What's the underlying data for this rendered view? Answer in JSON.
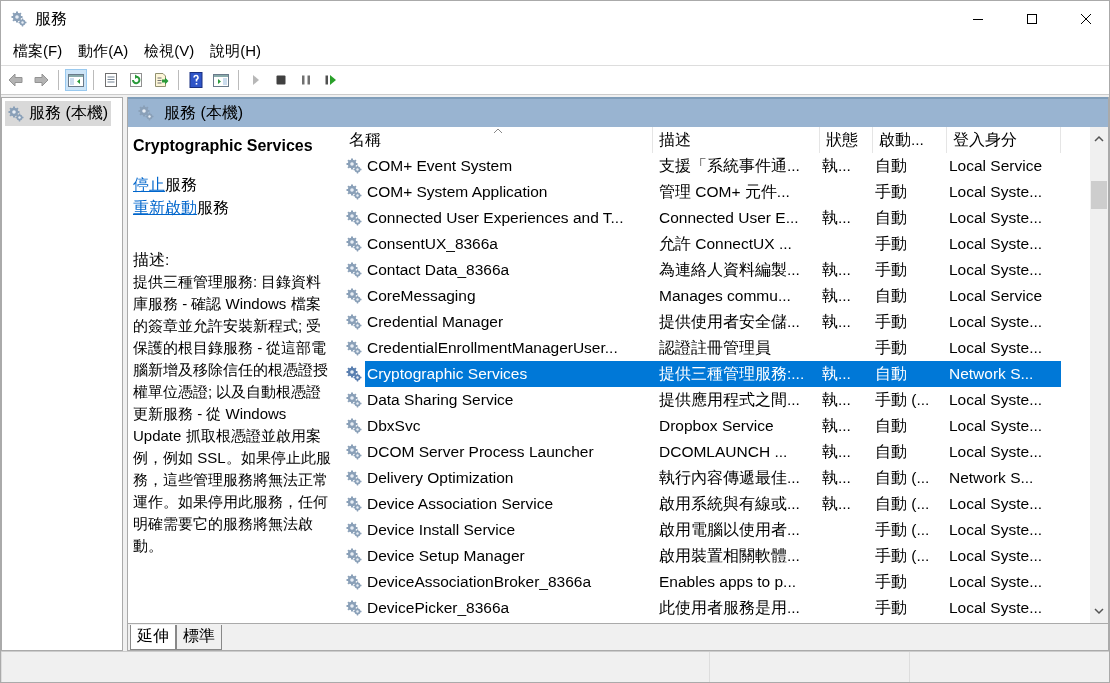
{
  "window": {
    "title": "服務"
  },
  "menu": [
    "檔案(F)",
    "動作(A)",
    "檢視(V)",
    "說明(H)"
  ],
  "toolbar": [
    {
      "kind": "back",
      "disabled": true,
      "selected": false
    },
    {
      "kind": "forward",
      "disabled": true,
      "selected": false
    },
    {
      "kind": "separator"
    },
    {
      "kind": "tree-toggle",
      "disabled": false,
      "selected": true
    },
    {
      "kind": "separator"
    },
    {
      "kind": "properties",
      "disabled": false,
      "selected": false
    },
    {
      "kind": "refresh",
      "disabled": false,
      "selected": false
    },
    {
      "kind": "export",
      "disabled": false,
      "selected": false
    },
    {
      "kind": "separator"
    },
    {
      "kind": "help",
      "disabled": false,
      "selected": false
    },
    {
      "kind": "action-pane",
      "disabled": false,
      "selected": false
    },
    {
      "kind": "separator"
    },
    {
      "kind": "play",
      "disabled": true,
      "selected": false
    },
    {
      "kind": "stop",
      "disabled": false,
      "selected": false
    },
    {
      "kind": "pause",
      "disabled": false,
      "selected": false
    },
    {
      "kind": "resume",
      "disabled": false,
      "selected": false
    }
  ],
  "tree": {
    "items": [
      {
        "label": "服務 (本機)",
        "selected": true
      }
    ]
  },
  "panel": {
    "title": "服務 (本機)"
  },
  "details": {
    "name": "Cryptographic Services",
    "actions": [
      {
        "link": "停止",
        "text": "服務"
      },
      {
        "link": "重新啟動",
        "text": "服務"
      }
    ],
    "description_label": "描述:",
    "description": "提供三種管理服務: 目錄資料庫服務 - 確認 Windows 檔案的簽章並允許安裝新程式; 受保護的根目錄服務 - 從這部電腦新增及移除信任的根憑證授權單位憑證; 以及自動根憑證更新服務 - 從 Windows Update 抓取根憑證並啟用案例，例如 SSL。如果停止此服務，這些管理服務將無法正常運作。如果停用此服務，任何明確需要它的服務將無法啟動。"
  },
  "table": {
    "columns": [
      {
        "label": "名稱",
        "sorted": true
      },
      {
        "label": "描述"
      },
      {
        "label": "狀態"
      },
      {
        "label": "啟動..."
      },
      {
        "label": "登入身分"
      }
    ],
    "rows": [
      {
        "name": "COM+ Event System",
        "description": "支援「系統事件通...",
        "status": "執...",
        "startup": "自動",
        "logon": "Local Service",
        "selected": false
      },
      {
        "name": "COM+ System Application",
        "description": "管理 COM+ 元件...",
        "status": "",
        "startup": "手動",
        "logon": "Local Syste...",
        "selected": false
      },
      {
        "name": "Connected User Experiences and T...",
        "description": "Connected User E...",
        "status": "執...",
        "startup": "自動",
        "logon": "Local Syste...",
        "selected": false
      },
      {
        "name": "ConsentUX_8366a",
        "description": "允許 ConnectUX ...",
        "status": "",
        "startup": "手動",
        "logon": "Local Syste...",
        "selected": false
      },
      {
        "name": "Contact Data_8366a",
        "description": "為連絡人資料編製...",
        "status": "執...",
        "startup": "手動",
        "logon": "Local Syste...",
        "selected": false
      },
      {
        "name": "CoreMessaging",
        "description": "Manages commu...",
        "status": "執...",
        "startup": "自動",
        "logon": "Local Service",
        "selected": false
      },
      {
        "name": "Credential Manager",
        "description": "提供使用者安全儲...",
        "status": "執...",
        "startup": "手動",
        "logon": "Local Syste...",
        "selected": false
      },
      {
        "name": "CredentialEnrollmentManagerUser...",
        "description": "認證註冊管理員",
        "status": "",
        "startup": "手動",
        "logon": "Local Syste...",
        "selected": false
      },
      {
        "name": "Cryptographic Services",
        "description": "提供三種管理服務:...",
        "status": "執...",
        "startup": "自動",
        "logon": "Network S...",
        "selected": true
      },
      {
        "name": "Data Sharing Service",
        "description": "提供應用程式之間...",
        "status": "執...",
        "startup": "手動 (...",
        "logon": "Local Syste...",
        "selected": false
      },
      {
        "name": "DbxSvc",
        "description": "Dropbox Service",
        "status": "執...",
        "startup": "自動",
        "logon": "Local Syste...",
        "selected": false
      },
      {
        "name": "DCOM Server Process Launcher",
        "description": "DCOMLAUNCH ...",
        "status": "執...",
        "startup": "自動",
        "logon": "Local Syste...",
        "selected": false
      },
      {
        "name": "Delivery Optimization",
        "description": "執行內容傳遞最佳...",
        "status": "執...",
        "startup": "自動 (...",
        "logon": "Network S...",
        "selected": false
      },
      {
        "name": "Device Association Service",
        "description": "啟用系統與有線或...",
        "status": "執...",
        "startup": "自動 (...",
        "logon": "Local Syste...",
        "selected": false
      },
      {
        "name": "Device Install Service",
        "description": "啟用電腦以使用者...",
        "status": "",
        "startup": "手動 (...",
        "logon": "Local Syste...",
        "selected": false
      },
      {
        "name": "Device Setup Manager",
        "description": "啟用裝置相關軟體...",
        "status": "",
        "startup": "手動 (...",
        "logon": "Local Syste...",
        "selected": false
      },
      {
        "name": "DeviceAssociationBroker_8366a",
        "description": "Enables apps to p...",
        "status": "",
        "startup": "手動",
        "logon": "Local Syste...",
        "selected": false
      },
      {
        "name": "DevicePicker_8366a",
        "description": "此使用者服務是用...",
        "status": "",
        "startup": "手動",
        "logon": "Local Syste...",
        "selected": false
      }
    ]
  },
  "tabs": [
    {
      "label": "延伸",
      "selected": true
    },
    {
      "label": "標準",
      "selected": false
    }
  ]
}
